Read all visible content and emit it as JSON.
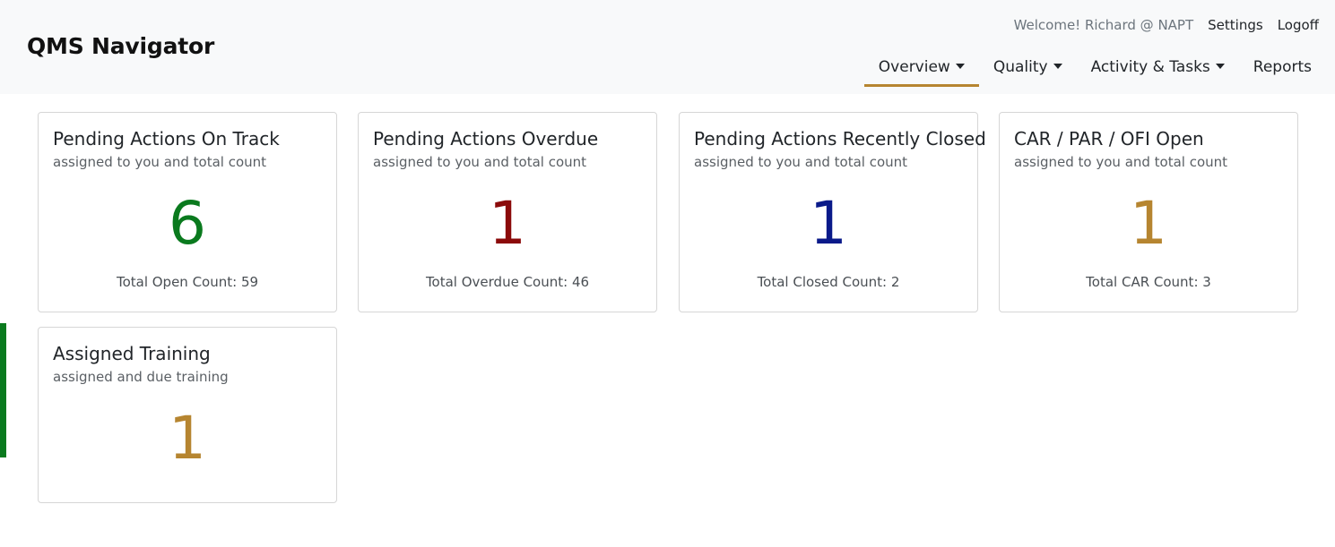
{
  "app": {
    "title": "QMS Navigator"
  },
  "header": {
    "welcome": "Welcome! Richard @ NAPT",
    "settings_label": "Settings",
    "logoff_label": "Logoff"
  },
  "nav": [
    {
      "label": "Overview",
      "has_caret": true,
      "active": true
    },
    {
      "label": "Quality",
      "has_caret": true,
      "active": false
    },
    {
      "label": "Activity & Tasks",
      "has_caret": true,
      "active": false
    },
    {
      "label": "Reports",
      "has_caret": false,
      "active": false
    }
  ],
  "colors": {
    "accent": "#b68530",
    "green": "#0a7a1e",
    "red": "#8b0a0a",
    "navy": "#0a1a8a",
    "gold": "#b68530",
    "side_accent": "#0a7a1e"
  },
  "cards": [
    {
      "title": "Pending Actions On Track",
      "subtitle": "assigned to you and total count",
      "count": "6",
      "count_color": "#0a7a1e",
      "footer": "Total Open Count: 59"
    },
    {
      "title": "Pending Actions Overdue",
      "subtitle": "assigned to you and total count",
      "count": "1",
      "count_color": "#8b0a0a",
      "footer": "Total Overdue Count: 46"
    },
    {
      "title": "Pending Actions Recently Closed",
      "subtitle": "assigned to you and total count",
      "count": "1",
      "count_color": "#0a1a8a",
      "footer": "Total Closed Count: 2"
    },
    {
      "title": "CAR / PAR / OFI Open",
      "subtitle": "assigned to you and total count",
      "count": "1",
      "count_color": "#b68530",
      "footer": "Total CAR Count: 3"
    },
    {
      "title": "Assigned Training",
      "subtitle": "assigned and due training",
      "count": "1",
      "count_color": "#b68530",
      "footer": ""
    }
  ]
}
